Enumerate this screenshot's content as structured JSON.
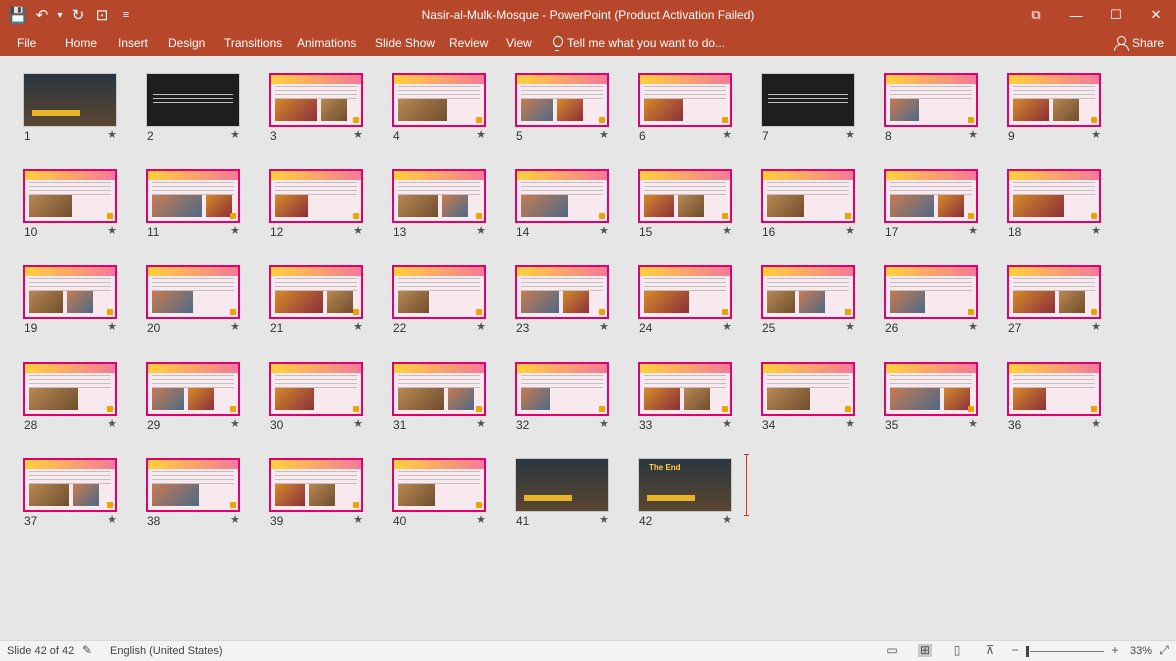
{
  "app": {
    "title": "Nasir-al-Mulk-Mosque - PowerPoint (Product Activation Failed)",
    "qat": [
      {
        "name": "save-icon",
        "glyph": "💾"
      },
      {
        "name": "undo-icon",
        "glyph": "↶"
      },
      {
        "name": "undo-dropdown-icon",
        "glyph": "▾"
      },
      {
        "name": "redo-icon",
        "glyph": "↻"
      },
      {
        "name": "start-from-beginning-icon",
        "glyph": "⊡"
      },
      {
        "name": "customize-qat-icon",
        "glyph": "≡"
      }
    ],
    "window_controls": [
      {
        "name": "ribbon-display-options-icon",
        "glyph": "⧉"
      },
      {
        "name": "minimize-icon",
        "glyph": "—"
      },
      {
        "name": "maximize-icon",
        "glyph": "☐"
      },
      {
        "name": "close-icon",
        "glyph": "✕"
      }
    ]
  },
  "ribbon": {
    "tabs": [
      "File",
      "Home",
      "Insert",
      "Design",
      "Transitions",
      "Animations",
      "Slide Show",
      "Review",
      "View"
    ],
    "tell_me": "Tell me what you want to do...",
    "share": "Share"
  },
  "sorter": {
    "slides": [
      {
        "n": "1",
        "kind": "dark-photo"
      },
      {
        "n": "2",
        "kind": "dark-text"
      },
      {
        "n": "3",
        "kind": "content"
      },
      {
        "n": "4",
        "kind": "content"
      },
      {
        "n": "5",
        "kind": "content"
      },
      {
        "n": "6",
        "kind": "content"
      },
      {
        "n": "7",
        "kind": "dark-text"
      },
      {
        "n": "8",
        "kind": "content"
      },
      {
        "n": "9",
        "kind": "content"
      },
      {
        "n": "10",
        "kind": "content"
      },
      {
        "n": "11",
        "kind": "content"
      },
      {
        "n": "12",
        "kind": "content"
      },
      {
        "n": "13",
        "kind": "content"
      },
      {
        "n": "14",
        "kind": "content"
      },
      {
        "n": "15",
        "kind": "content"
      },
      {
        "n": "16",
        "kind": "content"
      },
      {
        "n": "17",
        "kind": "content"
      },
      {
        "n": "18",
        "kind": "content"
      },
      {
        "n": "19",
        "kind": "content"
      },
      {
        "n": "20",
        "kind": "content"
      },
      {
        "n": "21",
        "kind": "content"
      },
      {
        "n": "22",
        "kind": "content"
      },
      {
        "n": "23",
        "kind": "content"
      },
      {
        "n": "24",
        "kind": "content"
      },
      {
        "n": "25",
        "kind": "content"
      },
      {
        "n": "26",
        "kind": "content"
      },
      {
        "n": "27",
        "kind": "content"
      },
      {
        "n": "28",
        "kind": "content"
      },
      {
        "n": "29",
        "kind": "content"
      },
      {
        "n": "30",
        "kind": "content"
      },
      {
        "n": "31",
        "kind": "content"
      },
      {
        "n": "32",
        "kind": "content"
      },
      {
        "n": "33",
        "kind": "content"
      },
      {
        "n": "34",
        "kind": "content"
      },
      {
        "n": "35",
        "kind": "content"
      },
      {
        "n": "36",
        "kind": "content"
      },
      {
        "n": "37",
        "kind": "content"
      },
      {
        "n": "38",
        "kind": "content"
      },
      {
        "n": "39",
        "kind": "content"
      },
      {
        "n": "40",
        "kind": "content"
      },
      {
        "n": "41",
        "kind": "dark-photo"
      },
      {
        "n": "42",
        "kind": "dark-photo"
      }
    ],
    "slide_42_text": "The End",
    "star_glyph": "★"
  },
  "status": {
    "slide_counter": "Slide 42 of 42",
    "language": "English (United States)",
    "zoom": "33%",
    "zoom_minus": "−",
    "zoom_plus": "+",
    "views": [
      {
        "name": "normal-view-icon",
        "glyph": "▭"
      },
      {
        "name": "slide-sorter-view-icon",
        "glyph": "⊞",
        "active": true
      },
      {
        "name": "reading-view-icon",
        "glyph": "▯"
      },
      {
        "name": "slide-show-view-icon",
        "glyph": "⊼"
      }
    ],
    "fit_glyph": "⤢"
  },
  "colors": {
    "ribbon": "#b7472a",
    "slide_accent": "#e0006e",
    "background": "#e6e6e6"
  }
}
